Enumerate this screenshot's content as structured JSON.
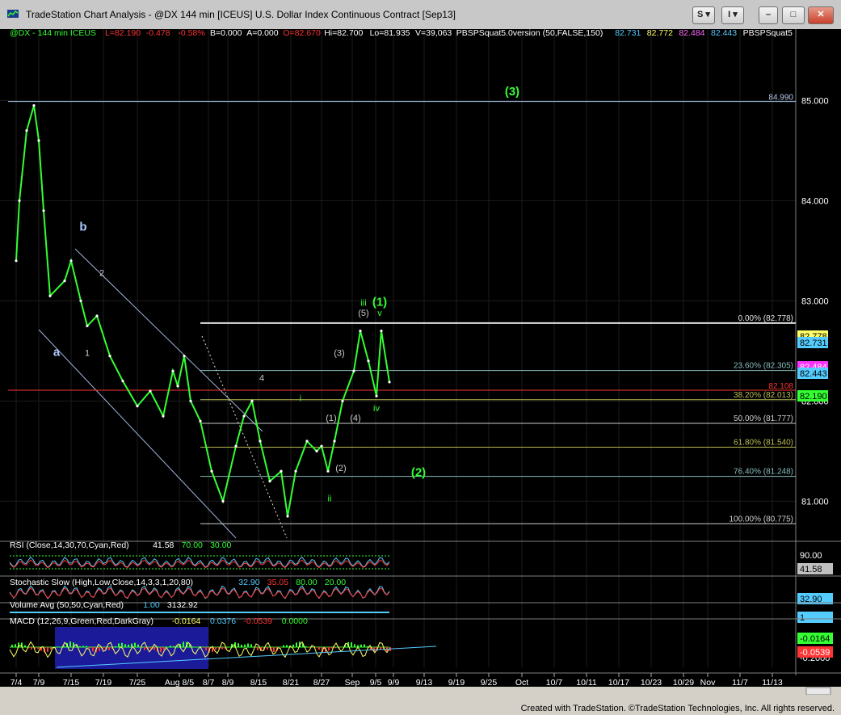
{
  "window": {
    "title": "TradeStation Chart Analysis - @DX 144 min [ICEUS] U.S. Dollar Index Continuous Contract [Sep13]",
    "buttons": {
      "s_menu": "S ▾",
      "i_menu": "I ▾",
      "minimize": "–",
      "maximize": "□",
      "close": "✕"
    },
    "footer": "Created with TradeStation. ©TradeStation Technologies, Inc. All rights reserved."
  },
  "header_legend": [
    {
      "text": "@DX - 144 min  ICEUS",
      "color": "#33ff33"
    },
    {
      "text": "L=82.190",
      "color": "#ff3333"
    },
    {
      "text": "-0.478",
      "color": "#ff3333"
    },
    {
      "text": "-0.58%",
      "color": "#ff3333"
    },
    {
      "text": "B=0.000",
      "color": "#ffffff"
    },
    {
      "text": "A=0.000",
      "color": "#ffffff"
    },
    {
      "text": "O=82.670",
      "color": "#ff3333"
    },
    {
      "text": "Hi=82.700",
      "color": "#ffffff"
    },
    {
      "text": "Lo=81.935",
      "color": "#ffffff"
    },
    {
      "text": "V=39,063",
      "color": "#ffffff"
    },
    {
      "text": "PBSPSquat5.0version (50,FALSE,150)",
      "color": "#ffffff"
    },
    {
      "text": "82.731",
      "color": "#55ccff"
    },
    {
      "text": "82.772",
      "color": "#ffff66"
    },
    {
      "text": "82.484",
      "color": "#ff66ff"
    },
    {
      "text": "82.443",
      "color": "#55ccff"
    },
    {
      "text": "PBSPSquat5",
      "color": "#ffffff"
    }
  ],
  "chart_data": {
    "type": "line",
    "symbol": "@DX",
    "interval": "144 min",
    "ylim": [
      80.6,
      85.6
    ],
    "y_ticks": [
      "85.000",
      "84.000",
      "83.000",
      "82.000",
      "81.000"
    ],
    "x_ticks": [
      "7/4",
      "7/9",
      "7/15",
      "7/19",
      "7/25",
      "Aug 8/5",
      "8/7",
      "8/9",
      "8/15",
      "8/21",
      "8/27",
      "Sep",
      "9/5",
      "9/9",
      "9/13",
      "9/19",
      "9/25",
      "Oct",
      "10/7",
      "10/11",
      "10/17",
      "10/23",
      "10/29",
      "Nov",
      "11/7",
      "11/13"
    ],
    "series": [
      {
        "color": "#33ff33",
        "points": [
          [
            "7/4",
            83.4
          ],
          [
            "7/5",
            84.0
          ],
          [
            "7/8",
            84.7
          ],
          [
            "7/9",
            84.95
          ],
          [
            "7/10",
            84.6
          ],
          [
            "7/11",
            83.9
          ],
          [
            "7/12",
            83.05
          ],
          [
            "7/15",
            83.2
          ],
          [
            "7/16",
            83.4
          ],
          [
            "7/17",
            83.0
          ],
          [
            "7/18",
            82.75
          ],
          [
            "7/19",
            82.85
          ],
          [
            "7/22",
            82.45
          ],
          [
            "7/24",
            82.2
          ],
          [
            "7/26",
            81.95
          ],
          [
            "7/29",
            82.1
          ],
          [
            "7/31",
            81.85
          ],
          [
            "Aug 8/1",
            82.3
          ],
          [
            "8/2",
            82.15
          ],
          [
            "8/5",
            82.45
          ],
          [
            "8/6",
            82.0
          ],
          [
            "8/7",
            81.8
          ],
          [
            "8/8",
            81.3
          ],
          [
            "8/9",
            81.0
          ],
          [
            "8/12",
            81.55
          ],
          [
            "8/14",
            81.85
          ],
          [
            "8/15",
            82.0
          ],
          [
            "8/16",
            81.6
          ],
          [
            "8/19",
            81.2
          ],
          [
            "8/20",
            81.3
          ],
          [
            "8/21",
            80.85
          ],
          [
            "8/22",
            81.3
          ],
          [
            "8/23",
            81.6
          ],
          [
            "8/26",
            81.5
          ],
          [
            "8/27",
            81.55
          ],
          [
            "8/28",
            81.3
          ],
          [
            "8/29",
            81.6
          ],
          [
            "8/30",
            82.0
          ],
          [
            "Sep 9/2",
            82.3
          ],
          [
            "9/3",
            82.7
          ],
          [
            "9/4",
            82.4
          ],
          [
            "9/5",
            82.05
          ],
          [
            "9/6",
            82.7
          ],
          [
            "9/9",
            82.19
          ]
        ]
      }
    ],
    "fibonacci": {
      "levels": [
        {
          "label": "0.00% (82.778)",
          "value": 82.778,
          "color": "#e0e0e0"
        },
        {
          "label": "23.60% (82.305)",
          "value": 82.305,
          "color": "#88bbbb"
        },
        {
          "label": "38.20% (82.013)",
          "value": 82.013,
          "color": "#bbbb55"
        },
        {
          "label": "50.00% (81.777)",
          "value": 81.777,
          "color": "#cccccc"
        },
        {
          "label": "61.80% (81.540)",
          "value": 81.54,
          "color": "#bbbb55"
        },
        {
          "label": "76.40% (81.248)",
          "value": 81.248,
          "color": "#88bbbb"
        },
        {
          "label": "100.00% (80.775)",
          "value": 80.775,
          "color": "#cccccc"
        }
      ]
    },
    "horizontal_lines": [
      {
        "label": "84.990",
        "value": 84.99,
        "color": "#a8c8e8"
      },
      {
        "label": "82.108",
        "value": 82.108,
        "color": "#ff3333"
      }
    ],
    "price_tags": [
      {
        "label": "82.778",
        "value": 82.8,
        "bg": "#ffff66",
        "fg": "#000000"
      },
      {
        "label": "82.731",
        "value": 82.73,
        "bg": "#55ccff",
        "fg": "#000000"
      },
      {
        "label": "82.484",
        "value": 82.48,
        "bg": "#ff33ff",
        "fg": "#ffffff"
      },
      {
        "label": "82.443",
        "value": 82.43,
        "bg": "#55ccff",
        "fg": "#000000"
      },
      {
        "label": "82.190",
        "value": 82.19,
        "bg": "#33ff33",
        "fg": "#000000"
      }
    ],
    "wave_labels": [
      {
        "text": "(3)",
        "x": "9/27",
        "y": 85.05,
        "color": "#33ff33"
      },
      {
        "text": "b",
        "x": "7/16",
        "y": 83.7,
        "color": "#aac8ff"
      },
      {
        "text": "a",
        "x": "7/12",
        "y": 82.45,
        "color": "#aac8ff"
      },
      {
        "text": "2",
        "x": "7/19",
        "y": 83.25,
        "color": "#cccccc"
      },
      {
        "text": "1",
        "x": "7/17",
        "y": 82.45,
        "color": "#cccccc"
      },
      {
        "text": "4",
        "x": "8/15",
        "y": 82.2,
        "color": "#cccccc"
      },
      {
        "text": "iii",
        "x": "9/4",
        "y": 82.95,
        "color": "#33ff33"
      },
      {
        "text": "(1)",
        "x": "9/6",
        "y": 82.95,
        "color": "#33ff33"
      },
      {
        "text": "(5)",
        "x": "9/4",
        "y": 82.85,
        "color": "#cccccc"
      },
      {
        "text": "v",
        "x": "9/6",
        "y": 82.85,
        "color": "#33ff33"
      },
      {
        "text": "(3)",
        "x": "8/30",
        "y": 82.45,
        "color": "#cccccc"
      },
      {
        "text": "iv",
        "x": "9/5",
        "y": 81.9,
        "color": "#33ff33"
      },
      {
        "text": "(4)",
        "x": "8/30",
        "y": 81.8,
        "color": "#cccccc"
      },
      {
        "text": "(1)",
        "x": "8/28",
        "y": 81.8,
        "color": "#cccccc"
      },
      {
        "text": "i",
        "x": "8/26",
        "y": 82.0,
        "color": "#33ff33"
      },
      {
        "text": "(2)",
        "x": "8/29",
        "y": 81.3,
        "color": "#cccccc"
      },
      {
        "text": "ii",
        "x": "8/28",
        "y": 81.0,
        "color": "#33ff33"
      },
      {
        "text": "(2)",
        "x": "9/15",
        "y": 81.25,
        "color": "#33ff33"
      }
    ]
  },
  "indicators": [
    {
      "name": "rsi",
      "legend": [
        {
          "text": "RSI (Close,14,30,70,Cyan,Red)",
          "color": "#ffffff"
        },
        {
          "text": "41.58",
          "color": "#ffffff"
        },
        {
          "text": "70.00",
          "color": "#33ff33"
        },
        {
          "text": "30.00",
          "color": "#33ff33"
        }
      ],
      "axis_labels": [
        "90.00"
      ],
      "tag": {
        "label": "41.58",
        "bg": "#c0c0c0",
        "fg": "#000000"
      }
    },
    {
      "name": "stochastic",
      "legend": [
        {
          "text": "Stochastic Slow (High,Low,Close,14,3,3,1,20,80)",
          "color": "#ffffff"
        },
        {
          "text": "32.90",
          "color": "#55ccff"
        },
        {
          "text": "35.05",
          "color": "#ff3333"
        },
        {
          "text": "80.00",
          "color": "#33ff33"
        },
        {
          "text": "20.00",
          "color": "#33ff33"
        }
      ],
      "tag": {
        "label": "32.90",
        "bg": "#55ccff",
        "fg": "#000000"
      }
    },
    {
      "name": "volume",
      "legend": [
        {
          "text": "Volume Avg (50,50,Cyan,Red)",
          "color": "#ffffff"
        },
        {
          "text": "1.00",
          "color": "#55ccff"
        },
        {
          "text": "3132.92",
          "color": "#ffffff"
        }
      ],
      "tag": {
        "label": "1",
        "bg": "#55ccff",
        "fg": "#000000"
      }
    },
    {
      "name": "macd",
      "legend": [
        {
          "text": "MACD (12,26,9,Green,Red,DarkGray)",
          "color": "#ffffff"
        },
        {
          "text": "-0.0164",
          "color": "#ffff66"
        },
        {
          "text": "0.0376",
          "color": "#55ccff"
        },
        {
          "text": "-0.0539",
          "color": "#ff3333"
        },
        {
          "text": "0.0000",
          "color": "#33ff33"
        }
      ],
      "axis_labels": [
        "0.1000",
        "-0.2000"
      ],
      "tags": [
        {
          "label": "-0.0164",
          "bg": "#33ff33",
          "fg": "#000000"
        },
        {
          "label": "-0.0539",
          "bg": "#ff3333",
          "fg": "#ffffff"
        }
      ]
    }
  ]
}
